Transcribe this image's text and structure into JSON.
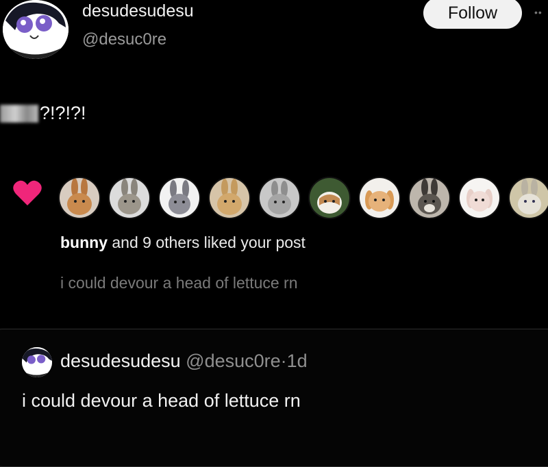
{
  "profile": {
    "display_name": "desudesudesu",
    "handle": "@desuc0re",
    "avatar_icon": "anime-avatar-icon"
  },
  "follow_label": "Follow",
  "more_icon": "more-horizontal-icon",
  "post": {
    "text": "?!?!?!"
  },
  "notification": {
    "heart_color": "#f0267a",
    "liker_count": 10,
    "liker_name": "bunny",
    "rest_text": " and 9 others liked your post",
    "preview": "i could devour a head of lettuce rn"
  },
  "quote": {
    "display_name": "desudesudesu",
    "handle": "@desuc0re",
    "separator": "·",
    "time": "1d",
    "text": "i could devour a head of lettuce rn"
  }
}
